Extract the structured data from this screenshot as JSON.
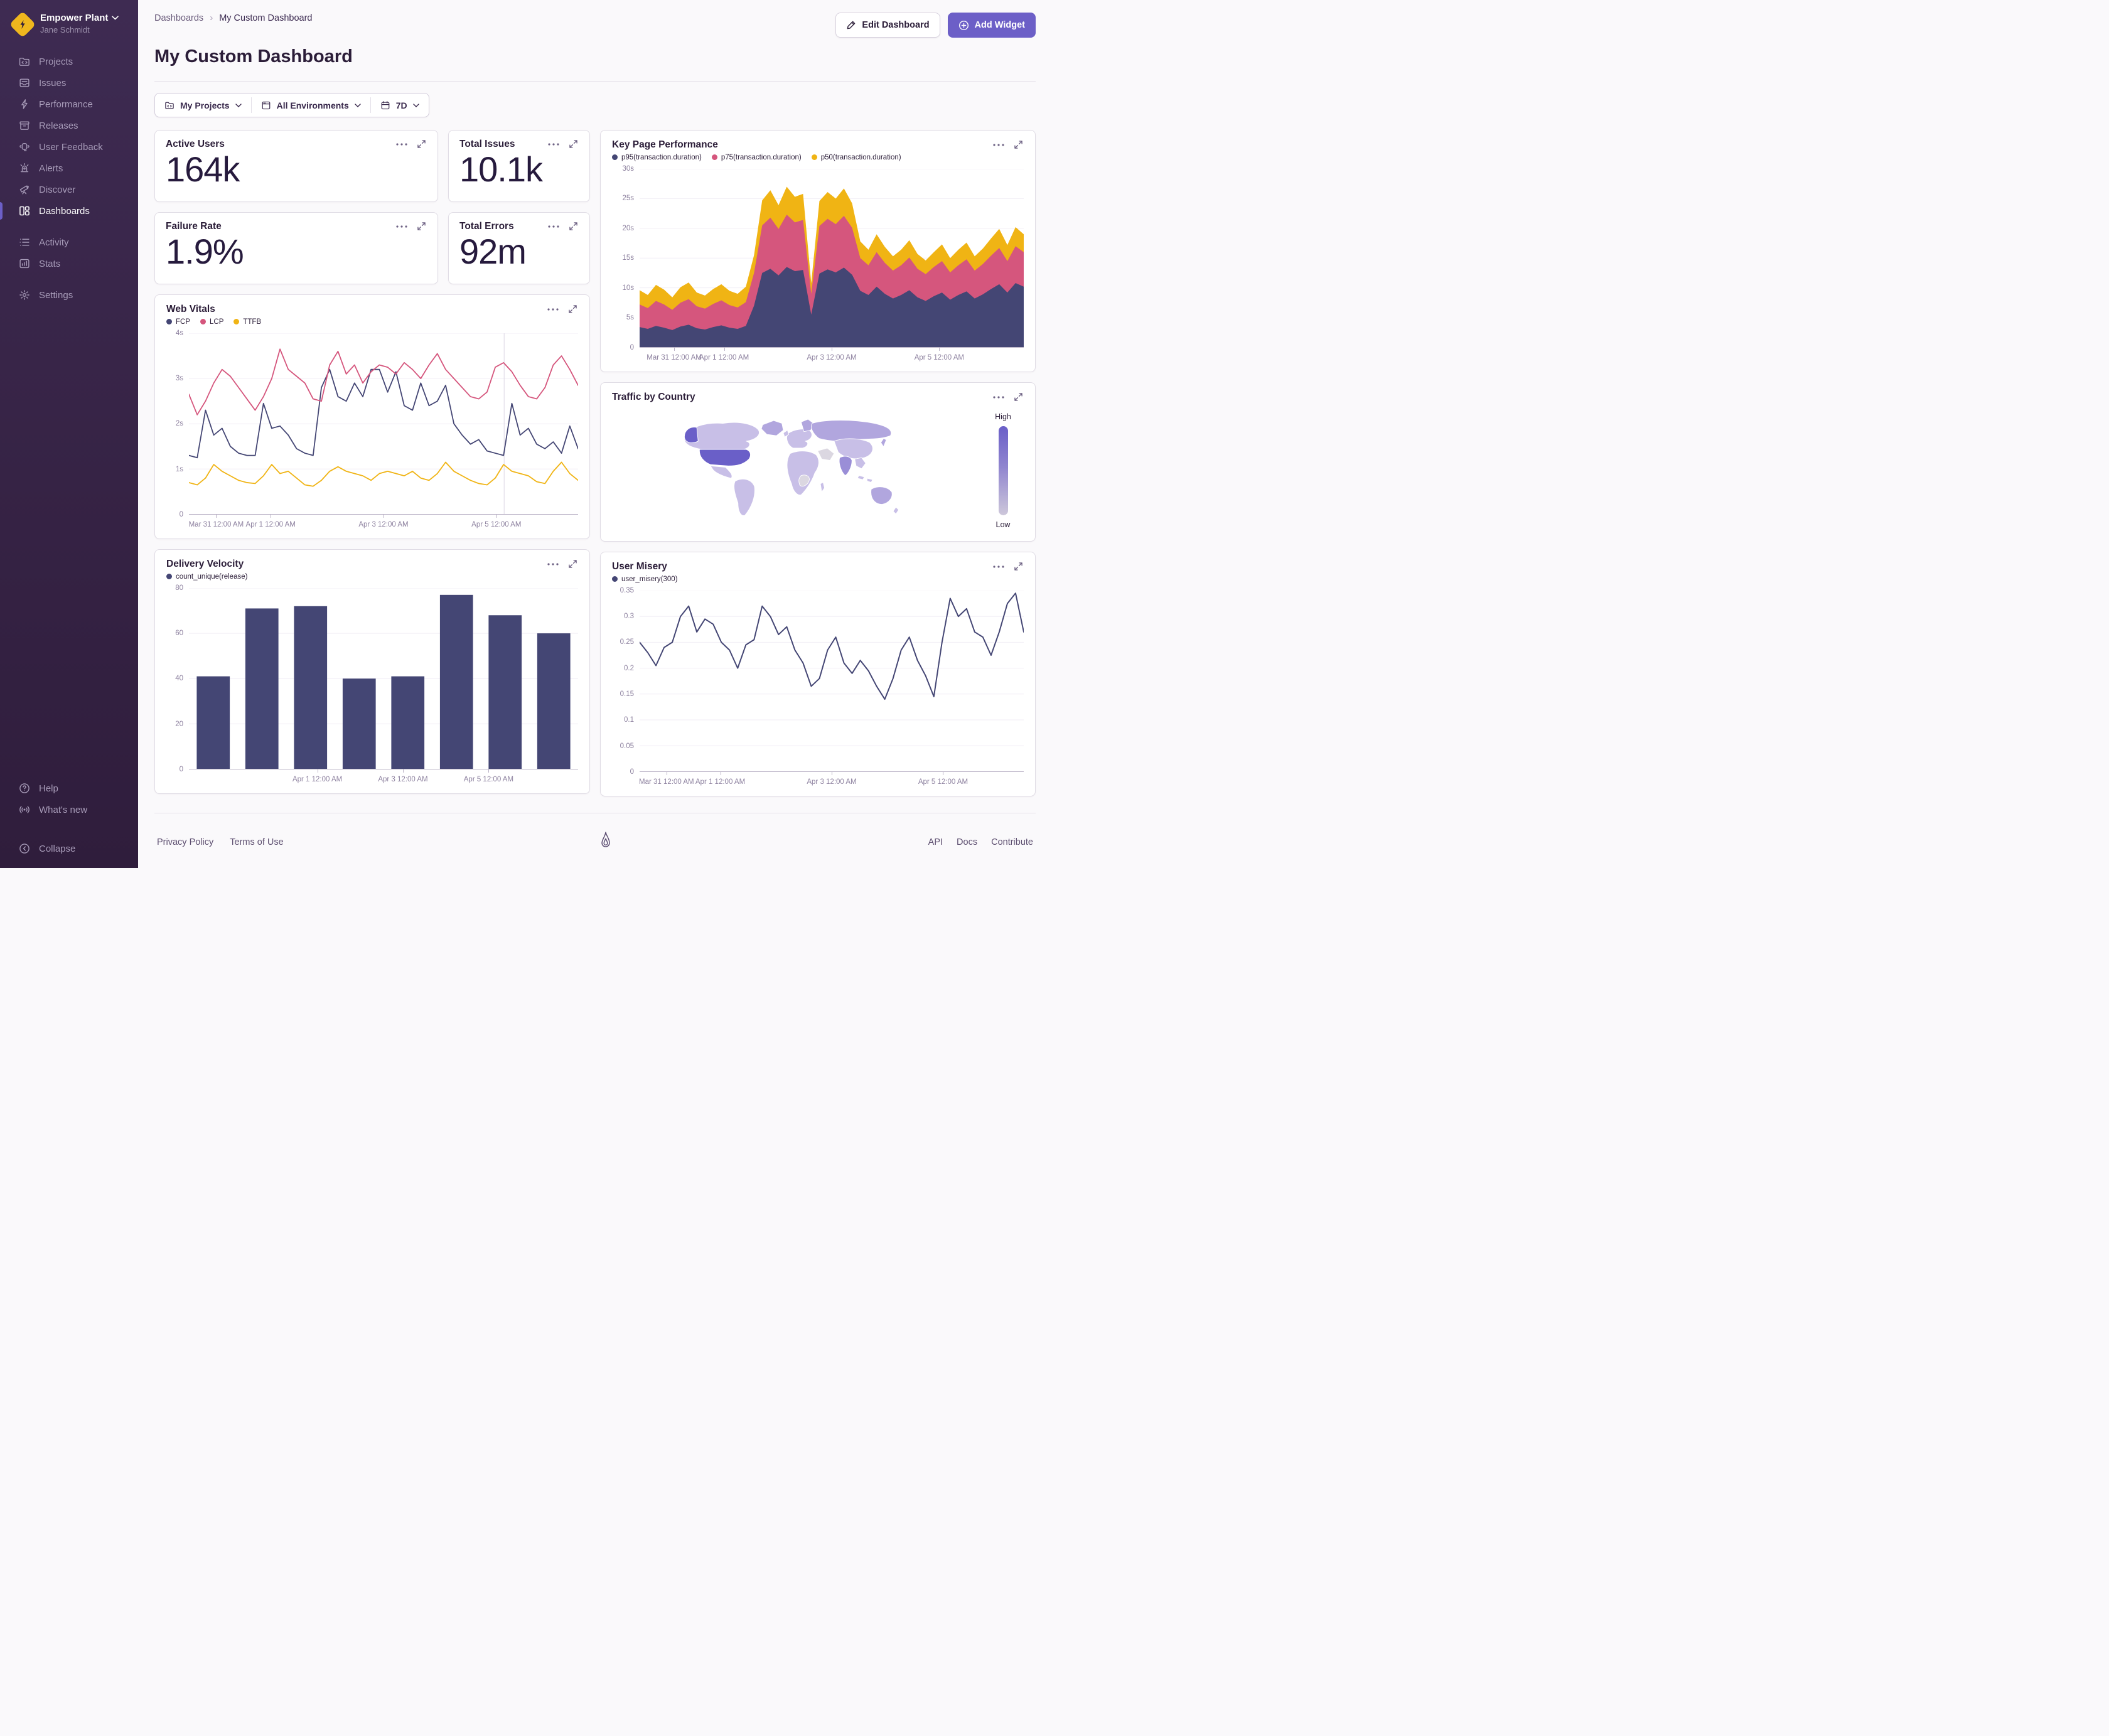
{
  "colors": {
    "accent": "#6C5FC7",
    "navy": "#444674",
    "pink": "#D5567D",
    "yellow": "#F0B414",
    "axis_label": "#8D819F",
    "grid": "#F1EEF5"
  },
  "sidebar": {
    "org": {
      "name": "Empower Plant",
      "user": "Jane Schmidt"
    },
    "items": [
      {
        "label": "Projects",
        "icon": "projects-icon"
      },
      {
        "label": "Issues",
        "icon": "issues-icon"
      },
      {
        "label": "Performance",
        "icon": "performance-icon"
      },
      {
        "label": "Releases",
        "icon": "releases-icon"
      },
      {
        "label": "User Feedback",
        "icon": "user-feedback-icon"
      },
      {
        "label": "Alerts",
        "icon": "alerts-icon"
      },
      {
        "label": "Discover",
        "icon": "discover-icon"
      },
      {
        "label": "Dashboards",
        "icon": "dashboards-icon",
        "active": true
      }
    ],
    "secondary": [
      {
        "label": "Activity",
        "icon": "activity-icon"
      },
      {
        "label": "Stats",
        "icon": "stats-icon"
      }
    ],
    "tertiary": [
      {
        "label": "Settings",
        "icon": "settings-icon"
      }
    ],
    "footer_items": [
      {
        "label": "Help",
        "icon": "help-icon"
      },
      {
        "label": "What's new",
        "icon": "broadcast-icon"
      }
    ],
    "collapse_label": "Collapse"
  },
  "header": {
    "breadcrumb": [
      "Dashboards",
      "My Custom Dashboard"
    ],
    "title": "My Custom Dashboard",
    "edit_button": "Edit Dashboard",
    "add_button": "Add Widget"
  },
  "filters": {
    "projects": "My Projects",
    "environments": "All Environments",
    "period": "7D"
  },
  "kpis": [
    {
      "title": "Active Users",
      "value": "164k"
    },
    {
      "title": "Total Issues",
      "value": "10.1k"
    },
    {
      "title": "Failure Rate",
      "value": "1.9%"
    },
    {
      "title": "Total Errors",
      "value": "92m"
    }
  ],
  "map": {
    "title": "Traffic by Country",
    "legend_high": "High",
    "legend_low": "Low",
    "base_color": "#C8BFE7",
    "mid_color": "#B1A6DE",
    "mid2_color": "#9A8ED7",
    "high_color": "#6A5FC8",
    "none_color": "#DBD7E1"
  },
  "footer": {
    "links_left": [
      "Privacy Policy",
      "Terms of Use"
    ],
    "links_right": [
      "API",
      "Docs",
      "Contribute"
    ]
  },
  "chart_data": {
    "key_page_performance": {
      "type": "stacked_area",
      "title": "Key Page Performance",
      "ylim": [
        0,
        30
      ],
      "y_ticks": [
        {
          "label": "30s",
          "value": 30
        },
        {
          "label": "25s",
          "value": 25
        },
        {
          "label": "20s",
          "value": 20
        },
        {
          "label": "15s",
          "value": 15
        },
        {
          "label": "10s",
          "value": 10
        },
        {
          "label": "5s",
          "value": 5
        },
        {
          "label": "0",
          "value": 0
        }
      ],
      "x_ticks": [
        {
          "label": "Mar 31 12:00 AM",
          "pct": 9
        },
        {
          "label": "Apr 1 12:00 AM",
          "pct": 22
        },
        {
          "label": "Apr 3 12:00 AM",
          "pct": 50
        },
        {
          "label": "Apr 5 12:00 AM",
          "pct": 78
        }
      ],
      "series": [
        {
          "name": "p95(transaction.duration)",
          "color": "#444674",
          "values": [
            3.4,
            3.1,
            3.6,
            3.3,
            2.9,
            3.5,
            3.8,
            3.2,
            3.0,
            3.4,
            3.7,
            3.3,
            3.1,
            3.6,
            7.0,
            12.5,
            13.2,
            12.1,
            13.5,
            12.8,
            13.0,
            5.5,
            12.4,
            13.1,
            12.6,
            13.4,
            12.2,
            9.5,
            8.8,
            10.2,
            9.0,
            8.2,
            8.8,
            9.6,
            8.4,
            7.8,
            8.6,
            9.2,
            8.0,
            8.8,
            9.4,
            8.2,
            8.9,
            9.8,
            10.6,
            9.2,
            10.8,
            10.2
          ]
        },
        {
          "name": "p75(transaction.duration)",
          "color": "#D5567D",
          "values": [
            3.8,
            3.5,
            4.2,
            3.9,
            3.4,
            4.0,
            4.3,
            3.7,
            3.5,
            3.9,
            4.2,
            3.8,
            3.6,
            4.0,
            5.5,
            8.0,
            8.6,
            7.8,
            8.8,
            8.2,
            8.4,
            3.5,
            8.0,
            8.5,
            8.1,
            8.7,
            7.9,
            5.5,
            5.0,
            5.8,
            5.2,
            4.7,
            5.0,
            5.5,
            4.8,
            4.5,
            4.9,
            5.3,
            4.6,
            5.0,
            5.4,
            4.7,
            5.1,
            5.6,
            6.1,
            5.3,
            6.2,
            5.8
          ]
        },
        {
          "name": "p50(transaction.duration)",
          "color": "#F0B414",
          "values": [
            2.4,
            2.2,
            2.7,
            2.5,
            2.1,
            2.6,
            2.8,
            2.3,
            2.2,
            2.5,
            2.7,
            2.4,
            2.3,
            2.6,
            3.0,
            4.2,
            4.6,
            4.0,
            4.7,
            4.3,
            4.4,
            1.8,
            4.2,
            4.5,
            4.3,
            4.6,
            4.1,
            2.8,
            2.6,
            3.0,
            2.7,
            2.4,
            2.6,
            2.9,
            2.5,
            2.3,
            2.5,
            2.8,
            2.4,
            2.6,
            2.8,
            2.4,
            2.6,
            2.9,
            3.2,
            2.7,
            3.2,
            3.0
          ]
        }
      ]
    },
    "web_vitals": {
      "type": "line",
      "title": "Web Vitals",
      "stroke": 1.8,
      "marker_pct": 81,
      "ylim": [
        0,
        4
      ],
      "y_ticks": [
        {
          "label": "4s",
          "value": 4
        },
        {
          "label": "3s",
          "value": 3
        },
        {
          "label": "2s",
          "value": 2
        },
        {
          "label": "1s",
          "value": 1
        },
        {
          "label": "0",
          "value": 0
        }
      ],
      "x_ticks": [
        {
          "label": "Mar 31 12:00 AM",
          "pct": 7
        },
        {
          "label": "Apr 1 12:00 AM",
          "pct": 21
        },
        {
          "label": "Apr 3 12:00 AM",
          "pct": 50
        },
        {
          "label": "Apr 5 12:00 AM",
          "pct": 79
        }
      ],
      "series": [
        {
          "name": "FCP",
          "color": "#444674",
          "values": [
            1.3,
            1.25,
            2.3,
            1.75,
            1.9,
            1.5,
            1.35,
            1.3,
            1.3,
            2.45,
            1.9,
            1.95,
            1.75,
            1.45,
            1.35,
            1.3,
            2.8,
            3.2,
            2.6,
            2.5,
            2.9,
            2.6,
            3.2,
            3.2,
            2.7,
            3.15,
            2.4,
            2.3,
            2.9,
            2.4,
            2.5,
            2.85,
            2.0,
            1.75,
            1.55,
            1.65,
            1.4,
            1.35,
            1.3,
            2.45,
            1.75,
            1.9,
            1.55,
            1.45,
            1.6,
            1.35,
            1.95,
            1.45
          ]
        },
        {
          "name": "LCP",
          "color": "#D5567D",
          "values": [
            2.65,
            2.2,
            2.5,
            2.9,
            3.2,
            3.05,
            2.8,
            2.55,
            2.3,
            2.6,
            3.0,
            3.65,
            3.2,
            3.05,
            2.9,
            2.55,
            2.5,
            3.3,
            3.6,
            3.1,
            3.3,
            2.9,
            3.15,
            3.3,
            3.25,
            3.1,
            3.35,
            3.2,
            3.0,
            3.3,
            3.55,
            3.2,
            3.0,
            2.8,
            2.6,
            2.55,
            2.7,
            3.25,
            3.35,
            3.15,
            2.85,
            2.6,
            2.55,
            2.8,
            3.3,
            3.5,
            3.2,
            2.85
          ]
        },
        {
          "name": "TTFB",
          "color": "#F0B414",
          "values": [
            0.7,
            0.65,
            0.8,
            1.1,
            0.95,
            0.85,
            0.75,
            0.7,
            0.68,
            0.85,
            1.1,
            0.9,
            0.95,
            0.8,
            0.65,
            0.62,
            0.75,
            0.95,
            1.05,
            0.95,
            0.9,
            0.85,
            0.75,
            0.9,
            0.95,
            0.9,
            0.85,
            0.95,
            0.8,
            0.75,
            0.9,
            1.15,
            0.95,
            0.85,
            0.75,
            0.68,
            0.65,
            0.8,
            1.1,
            0.95,
            0.9,
            0.85,
            0.72,
            0.68,
            0.95,
            1.15,
            0.9,
            0.75
          ]
        }
      ]
    },
    "delivery_velocity": {
      "type": "bar",
      "title": "Delivery Velocity",
      "ylim": [
        0,
        80
      ],
      "y_ticks": [
        {
          "label": "80",
          "value": 80
        },
        {
          "label": "60",
          "value": 60
        },
        {
          "label": "40",
          "value": 40
        },
        {
          "label": "20",
          "value": 20
        },
        {
          "label": "0",
          "value": 0
        }
      ],
      "x_ticks": [
        {
          "label": "Apr 1 12:00 AM",
          "pct": 33
        },
        {
          "label": "Apr 3 12:00 AM",
          "pct": 55
        },
        {
          "label": "Apr 5 12:00 AM",
          "pct": 77
        }
      ],
      "series": [
        {
          "name": "count_unique(release)",
          "color": "#444674",
          "values": [
            41,
            71,
            72,
            40,
            41,
            77,
            68,
            60
          ]
        }
      ]
    },
    "user_misery": {
      "type": "line",
      "title": "User Misery",
      "stroke": 2,
      "ylim": [
        0,
        0.35
      ],
      "y_ticks": [
        {
          "label": "0.35",
          "value": 0.35
        },
        {
          "label": "0.3",
          "value": 0.3
        },
        {
          "label": "0.25",
          "value": 0.25
        },
        {
          "label": "0.2",
          "value": 0.2
        },
        {
          "label": "0.15",
          "value": 0.15
        },
        {
          "label": "0.1",
          "value": 0.1
        },
        {
          "label": "0.05",
          "value": 0.05
        },
        {
          "label": "0",
          "value": 0
        }
      ],
      "x_ticks": [
        {
          "label": "Mar 31 12:00 AM",
          "pct": 7
        },
        {
          "label": "Apr 1 12:00 AM",
          "pct": 21
        },
        {
          "label": "Apr 3 12:00 AM",
          "pct": 50
        },
        {
          "label": "Apr 5 12:00 AM",
          "pct": 79
        }
      ],
      "series": [
        {
          "name": "user_misery(300)",
          "color": "#444674",
          "values": [
            0.25,
            0.23,
            0.205,
            0.24,
            0.25,
            0.3,
            0.32,
            0.27,
            0.295,
            0.285,
            0.25,
            0.235,
            0.2,
            0.245,
            0.255,
            0.32,
            0.3,
            0.265,
            0.28,
            0.235,
            0.21,
            0.165,
            0.18,
            0.235,
            0.26,
            0.21,
            0.19,
            0.215,
            0.195,
            0.165,
            0.14,
            0.18,
            0.235,
            0.26,
            0.215,
            0.185,
            0.145,
            0.25,
            0.335,
            0.3,
            0.315,
            0.27,
            0.26,
            0.225,
            0.27,
            0.325,
            0.345,
            0.27
          ]
        }
      ]
    }
  }
}
